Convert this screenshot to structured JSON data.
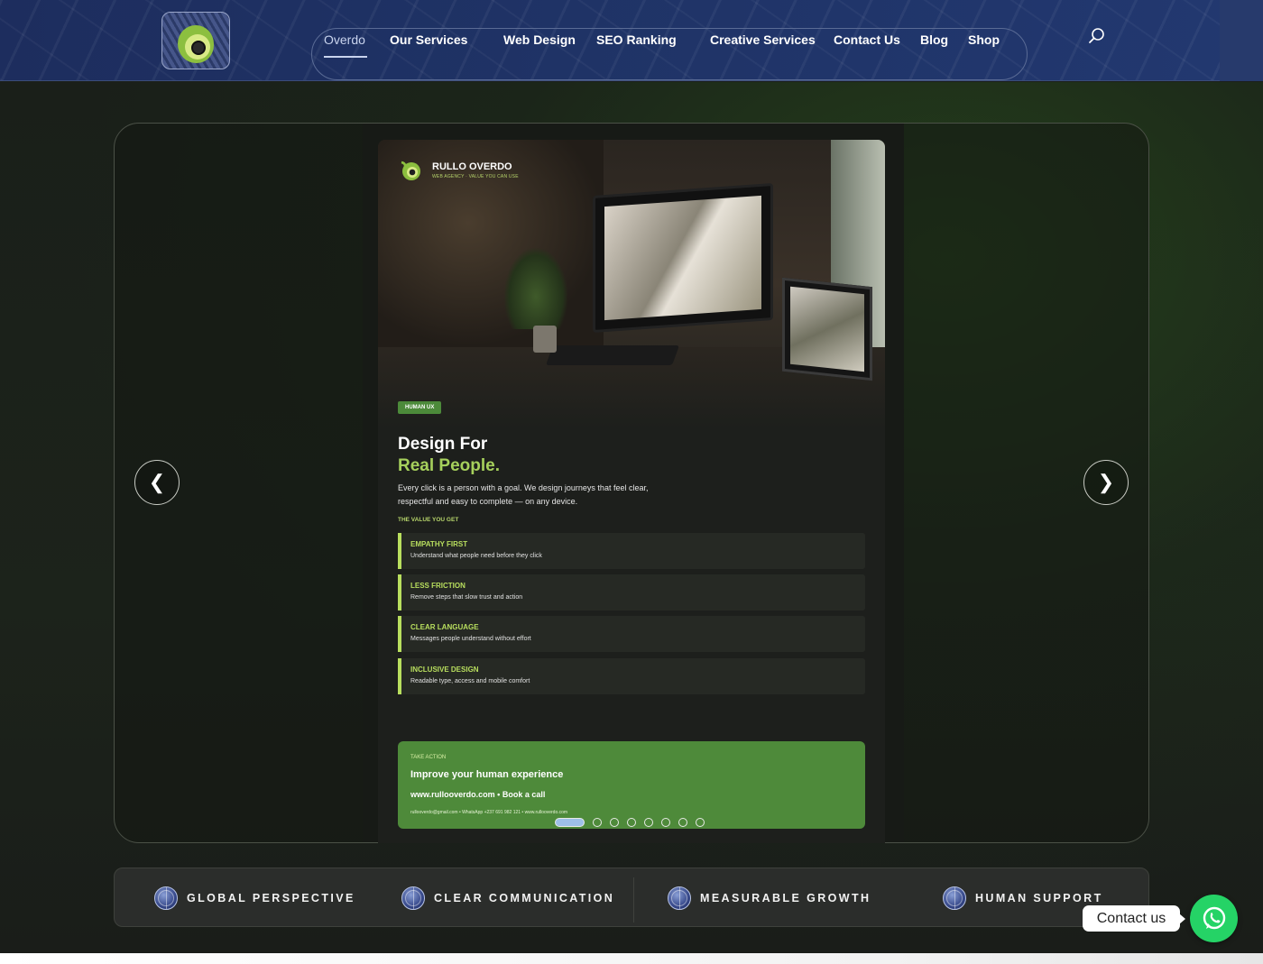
{
  "nav": {
    "items": [
      {
        "label": "Overdo",
        "active": true
      },
      {
        "label": "Our Services"
      },
      {
        "label": "Web Design"
      },
      {
        "label": "SEO Ranking"
      },
      {
        "label": "Creative Services"
      },
      {
        "label": "Contact Us"
      },
      {
        "label": "Blog"
      },
      {
        "label": "Shop"
      }
    ],
    "search_icon": "search-icon"
  },
  "slider": {
    "prev_label": "❮",
    "next_label": "❯",
    "slide_count": 8,
    "active_slide": 1
  },
  "slide": {
    "brand_name": "RULLO OVERDO",
    "brand_tagline": "WEB AGENCY · VALUE YOU CAN USE",
    "badge": "HUMAN UX",
    "headline_line1": "Design For",
    "headline_line2": "Real People.",
    "lede": "Every click is a person with a goal. We design journeys that feel clear, respectful and easy to complete — on any device.",
    "value_label": "THE VALUE YOU GET",
    "values": [
      {
        "title": "EMPATHY FIRST",
        "desc": "Understand what people need before they click"
      },
      {
        "title": "LESS FRICTION",
        "desc": "Remove steps that slow trust and action"
      },
      {
        "title": "CLEAR LANGUAGE",
        "desc": "Messages people understand without effort"
      },
      {
        "title": "INCLUSIVE DESIGN",
        "desc": "Readable type, access and mobile comfort"
      }
    ],
    "cta": {
      "kicker": "TAKE ACTION",
      "title": "Improve your human experience",
      "links": "www.rullooverdo.com  •  Book a call",
      "footer": "rullooverdo@gmail.com  •  WhatsApp +237 691 982 121  •  www.rullooverdo.com"
    }
  },
  "features": [
    {
      "label": "GLOBAL PERSPECTIVE",
      "icon": "globe-icon"
    },
    {
      "label": "CLEAR COMMUNICATION",
      "icon": "globe-icon"
    },
    {
      "label": "MEASURABLE GROWTH",
      "icon": "globe-icon"
    },
    {
      "label": "HUMAN SUPPORT",
      "icon": "globe-icon"
    }
  ],
  "whatsapp": {
    "label": "Contact us",
    "color": "#25d366"
  },
  "colors": {
    "accent_green": "#a6d05c",
    "header_blue": "#1f3366",
    "cta_green": "#4e8a3a"
  }
}
